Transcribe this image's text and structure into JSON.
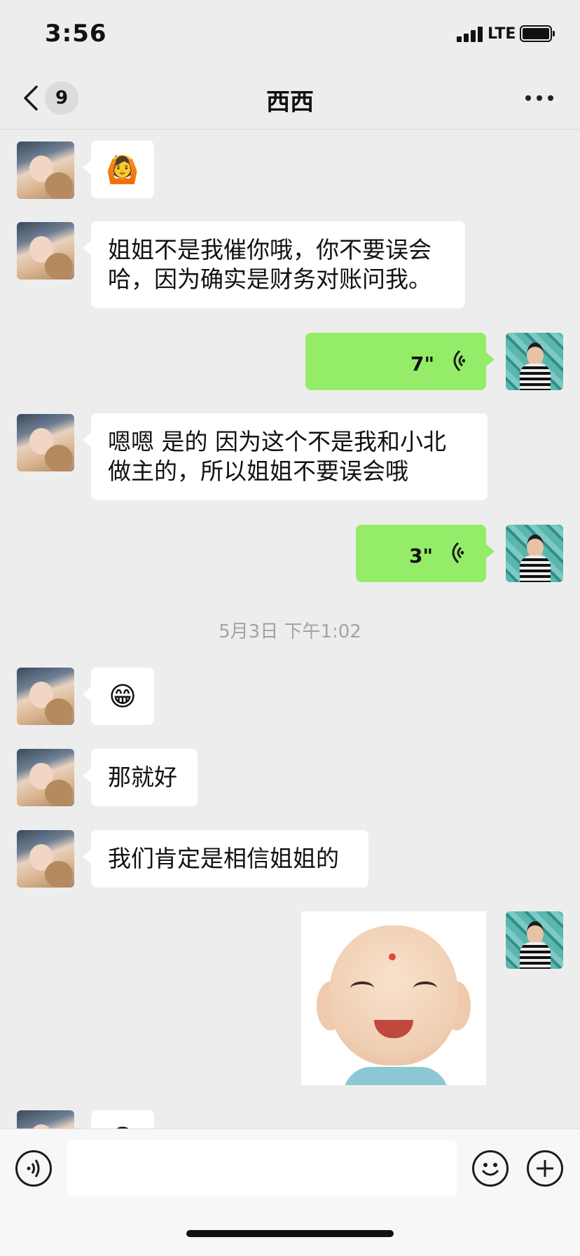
{
  "status_bar": {
    "time": "3:56",
    "network": "LTE"
  },
  "nav": {
    "unread_count": "9",
    "title": "西西"
  },
  "messages": {
    "m1_emoji": "🙆",
    "m2_text": "姐姐不是我催你哦，你不要误会\n哈，因为确实是财务对账问我。",
    "m3_voice_duration": "7\"",
    "m4_text": "嗯嗯  是的  因为这个不是我和小北\n做主的，所以姐姐不要误会哦",
    "m5_voice_duration": "3\"",
    "timestamp": "5月3日 下午1:02",
    "m6_emoji": "😁",
    "m7_text": "那就好",
    "m8_text": "我们肯定是相信姐姐的",
    "m10_emoji": "😊"
  },
  "input": {
    "placeholder": ""
  },
  "colors": {
    "background": "#ededed",
    "outgoing_bubble": "#95ec69",
    "incoming_bubble": "#ffffff",
    "timestamp_text": "#a3a3a3"
  },
  "icons": [
    "back-icon",
    "more-icon",
    "voice-wave-icon",
    "voice-input-icon",
    "emoji-icon",
    "plus-icon"
  ]
}
